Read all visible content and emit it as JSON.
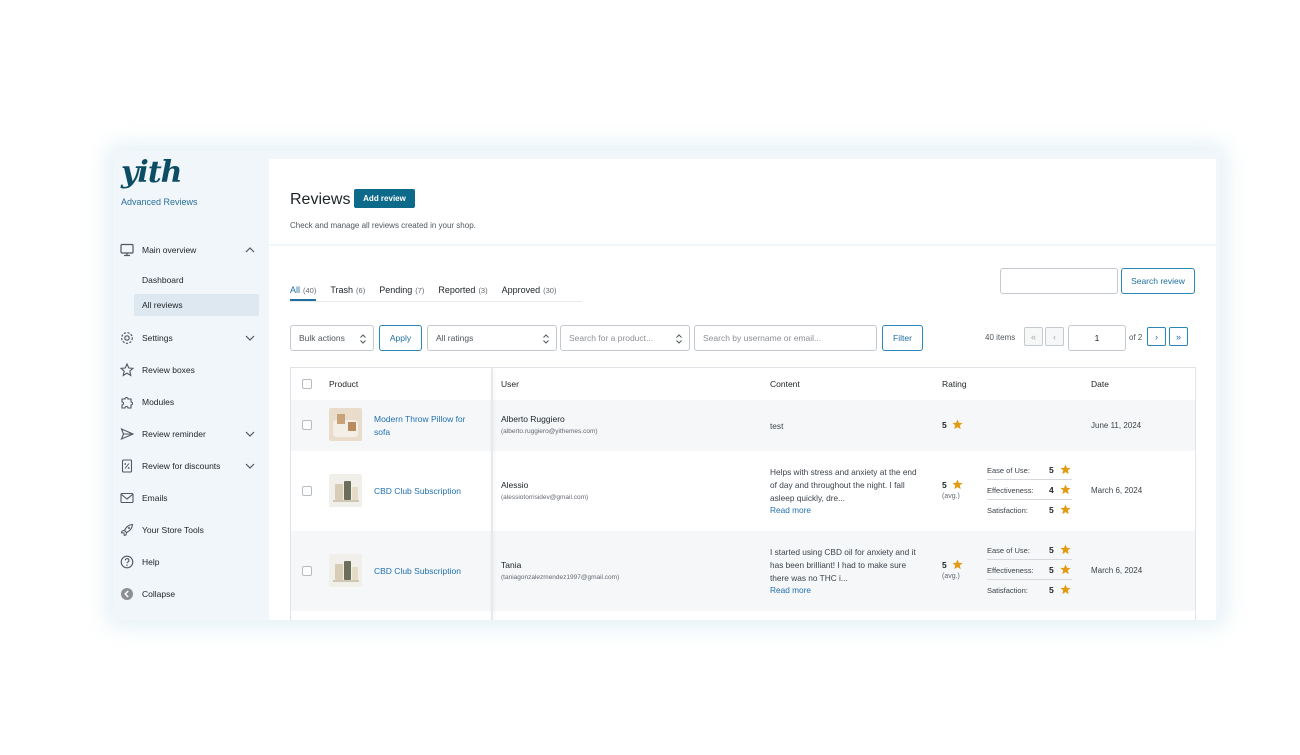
{
  "sidebar": {
    "logo": "yith",
    "subtitle": "Advanced Reviews",
    "items": [
      {
        "label": "Main overview",
        "icon": "monitor-icon"
      },
      {
        "label": "Settings",
        "icon": "gear-icon"
      },
      {
        "label": "Review boxes",
        "icon": "star-outline-icon"
      },
      {
        "label": "Modules",
        "icon": "puzzle-icon"
      },
      {
        "label": "Review reminder",
        "icon": "send-icon"
      },
      {
        "label": "Review for discounts",
        "icon": "discount-icon"
      },
      {
        "label": "Emails",
        "icon": "envelope-icon"
      },
      {
        "label": "Your Store Tools",
        "icon": "rocket-icon"
      },
      {
        "label": "Help",
        "icon": "help-circle-icon"
      },
      {
        "label": "Collapse",
        "icon": "collapse-icon"
      }
    ],
    "subitems": [
      {
        "label": "Dashboard"
      },
      {
        "label": "All reviews"
      }
    ]
  },
  "header": {
    "title": "Reviews",
    "add_button": "Add review",
    "description": "Check and manage all reviews created in your shop."
  },
  "tabs": [
    {
      "label": "All",
      "count": "(40)"
    },
    {
      "label": "Trash",
      "count": "(6)"
    },
    {
      "label": "Pending",
      "count": "(7)"
    },
    {
      "label": "Reported",
      "count": "(3)"
    },
    {
      "label": "Approved",
      "count": "(30)"
    }
  ],
  "search": {
    "placeholder": "",
    "button": "Search review"
  },
  "filters": {
    "bulk_actions": "Bulk actions",
    "apply": "Apply",
    "all_ratings": "All ratings",
    "product_placeholder": "Search for a product...",
    "user_placeholder": "Search by username or email...",
    "filter": "Filter"
  },
  "pagination": {
    "items": "40 items",
    "first": "«",
    "prev": "‹",
    "current": "1",
    "of": "of 2",
    "next": "›",
    "last": "»"
  },
  "table": {
    "headers": {
      "product": "Product",
      "user": "User",
      "content": "Content",
      "rating": "Rating",
      "date": "Date"
    },
    "rows": [
      {
        "product": "Modern Throw Pillow for sofa",
        "user": "Alberto Ruggiero",
        "email": "(alberto.ruggiero@yithemes.com)",
        "content": "test",
        "read_more": "",
        "rating": "5",
        "avg": "",
        "criteria": [],
        "date": "June 11, 2024"
      },
      {
        "product": "CBD Club Subscription",
        "user": "Alessio",
        "email": "(alessiotorrisidev@gmail.com)",
        "content": "Helps with stress and anxiety at the end of day and throughout the night. I fall asleep quickly, dre...",
        "read_more": "Read more",
        "rating": "5",
        "avg": "(avg.)",
        "criteria": [
          {
            "label": "Ease of Use:",
            "value": "5"
          },
          {
            "label": "Effectiveness:",
            "value": "4"
          },
          {
            "label": "Satisfaction:",
            "value": "5"
          }
        ],
        "date": "March 6, 2024"
      },
      {
        "product": "CBD Club Subscription",
        "user": "Tania",
        "email": "(taniagonzalezmendez1997@gmail.com)",
        "content": "I started using CBD oil for anxiety and it has been brilliant! I had to make sure there was no THC i...",
        "read_more": "Read more",
        "rating": "5",
        "avg": "(avg.)",
        "criteria": [
          {
            "label": "Ease of Use:",
            "value": "5"
          },
          {
            "label": "Effectiveness:",
            "value": "5"
          },
          {
            "label": "Satisfaction:",
            "value": "5"
          }
        ],
        "date": "March 6, 2024"
      }
    ]
  },
  "colors": {
    "accent": "#0e6a8a",
    "link": "#2271b1",
    "star": "#e29b12",
    "sidebar_bg": "#f0f6fa"
  }
}
